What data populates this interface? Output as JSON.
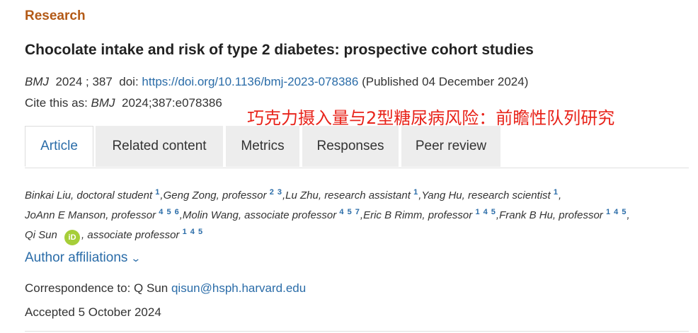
{
  "article_type": "Research",
  "title": "Chocolate intake and risk of type 2 diabetes: prospective cohort studies",
  "citation": {
    "journal": "BMJ",
    "year_volume": "2024 ; 387",
    "doi_label": "doi:",
    "doi_url": "https://doi.org/10.1136/bmj-2023-078386",
    "published": "(Published 04 December 2024)"
  },
  "cite_as": {
    "prefix": "Cite this as:",
    "journal": "BMJ",
    "ref": "2024;387:e078386"
  },
  "chinese_title": "巧克力摄入量与2型糖尿病风险：前瞻性队列研究",
  "tabs": [
    {
      "label": "Article",
      "active": true
    },
    {
      "label": "Related content",
      "active": false
    },
    {
      "label": "Metrics",
      "active": false
    },
    {
      "label": "Responses",
      "active": false
    },
    {
      "label": "Peer review",
      "active": false
    }
  ],
  "authors": [
    {
      "name": "Binkai Liu, doctoral student",
      "sup": "1",
      "sep": ","
    },
    {
      "name": "Geng Zong, professor",
      "sup": "2 3",
      "sep": ","
    },
    {
      "name": "Lu Zhu, research assistant",
      "sup": "1",
      "sep": ","
    },
    {
      "name": "Yang Hu, research scientist",
      "sup": "1",
      "sep": ","
    },
    {
      "name": "JoAnn E Manson, professor",
      "sup": "4 5 6",
      "sep": ","
    },
    {
      "name": "Molin Wang, associate professor",
      "sup": "4 5 7",
      "sep": ","
    },
    {
      "name": "Eric B Rimm, professor",
      "sup": "1 4 5",
      "sep": ","
    },
    {
      "name": "Frank B Hu, professor",
      "sup": "1 4 5",
      "sep": ","
    },
    {
      "name": "Qi Sun",
      "orcid": "iD",
      "role": ", associate professor",
      "sup": "1 4 5"
    }
  ],
  "affiliations_label": "Author affiliations",
  "correspondence": {
    "prefix": "Correspondence to: Q Sun",
    "email": "qisun@hsph.harvard.edu"
  },
  "accepted": "Accepted 5 October 2024",
  "colors": {
    "section_label": "#b35a17",
    "link": "#2a6ca8",
    "chinese_title": "#e8231a",
    "orcid": "#a6ce39",
    "tab_inactive_bg": "#ededed"
  }
}
